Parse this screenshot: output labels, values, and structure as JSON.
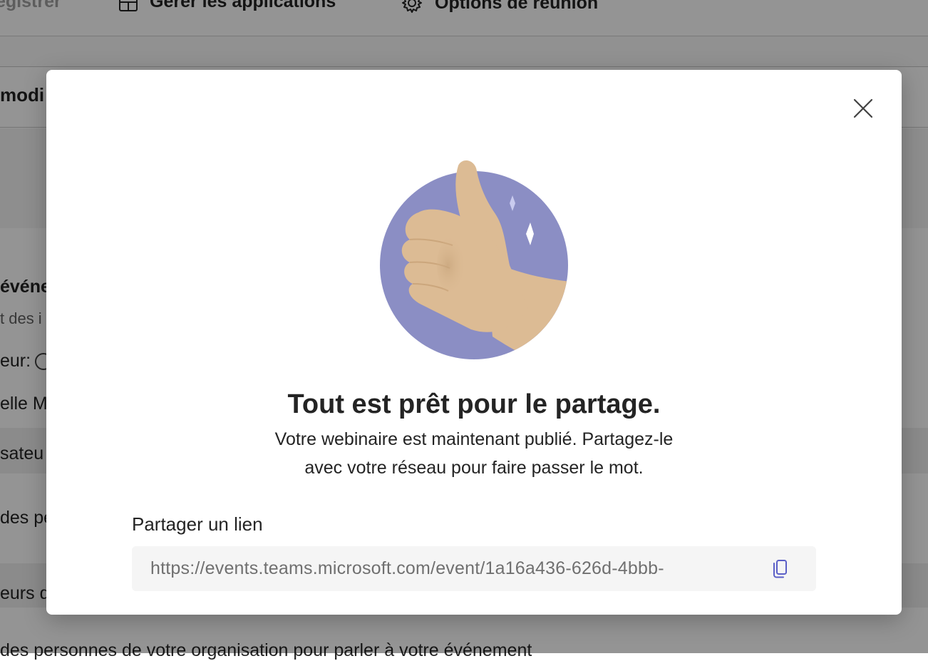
{
  "background": {
    "toolbar": {
      "register_label": "egistrer",
      "manage_apps_label": "Gérer les applications",
      "meeting_options_label": "Options de réunion"
    },
    "tab_fragment": "modi",
    "details": {
      "event_heading": "événe",
      "event_subtext": "t des i",
      "organizer_label": "eur:",
      "organizer_name": "elle M",
      "organizers_row": "sateu",
      "people_row": "des pe",
      "presenters_row": "eurs d",
      "bottom_text": "des personnes de votre organisation pour parler à votre événement"
    }
  },
  "dialog": {
    "close_icon": "close-icon",
    "illustration": "thumbs-up-illustration",
    "title": "Tout est prêt pour le partage.",
    "body_line1": "Votre webinaire est maintenant publié. Partagez-le",
    "body_line2": "avec votre réseau pour faire passer le mot.",
    "share_label": "Partager un lien",
    "link_value": "https://events.teams.microsoft.com/event/1a16a436-626d-4bbb-",
    "copy_icon": "copy-icon"
  },
  "colors": {
    "accent": "#5b5fc7",
    "circle": "#8b8ec4",
    "skin": "#dcbb94",
    "overlay": "rgba(0,0,0,0.42)"
  }
}
